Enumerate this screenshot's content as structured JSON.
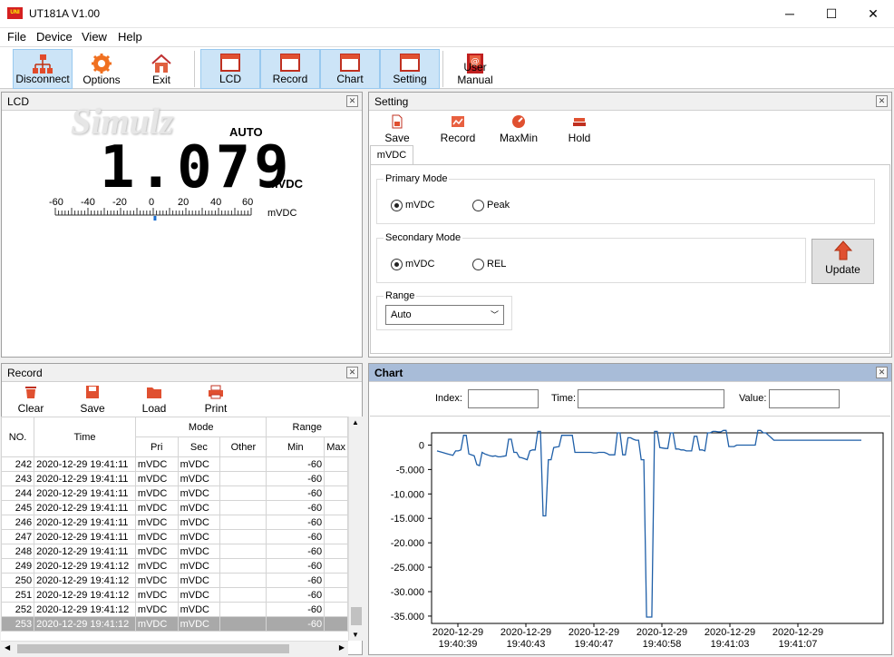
{
  "window": {
    "title": "UT181A V1.00",
    "minimize": "─",
    "maximize": "☐",
    "close": "✕"
  },
  "menu": [
    "File",
    "Device",
    "View",
    "Help"
  ],
  "toolbar": {
    "disconnect": "Disconnect",
    "options": "Options",
    "exit": "Exit",
    "lcd": "LCD",
    "record": "Record",
    "chart": "Chart",
    "setting": "Setting",
    "user_manual": "User Manual"
  },
  "lcd_panel": {
    "title": "LCD",
    "watermark": "Simulz",
    "range_mode": "AUTO",
    "reading": "1.079",
    "unit": "mVDC",
    "scale_unit": "mVDC",
    "scale_labels": [
      "-60",
      "-40",
      "-20",
      "0",
      "20",
      "40",
      "60"
    ],
    "bar_value": 1.079
  },
  "setting_panel": {
    "title": "Setting",
    "buttons": {
      "save": "Save",
      "record": "Record",
      "maxmin": "MaxMin",
      "hold": "Hold"
    },
    "tab": "mVDC",
    "primary_mode": {
      "label": "Primary Mode",
      "options": [
        "mVDC",
        "Peak"
      ],
      "selected": "mVDC"
    },
    "secondary_mode": {
      "label": "Secondary Mode",
      "options": [
        "mVDC",
        "REL"
      ],
      "selected": "mVDC"
    },
    "update": "Update",
    "range": {
      "label": "Range",
      "value": "Auto"
    }
  },
  "record_panel": {
    "title": "Record",
    "buttons": {
      "clear": "Clear",
      "save": "Save",
      "load": "Load",
      "print": "Print"
    },
    "headers": {
      "no": "NO.",
      "time": "Time",
      "mode": "Mode",
      "range": "Range",
      "pri": "Pri",
      "sec": "Sec",
      "other": "Other",
      "min": "Min",
      "max": "Max"
    },
    "rows": [
      {
        "no": "242",
        "time": "2020-12-29 19:41:11",
        "pri": "mVDC",
        "sec": "mVDC",
        "other": "",
        "min": "-60"
      },
      {
        "no": "243",
        "time": "2020-12-29 19:41:11",
        "pri": "mVDC",
        "sec": "mVDC",
        "other": "",
        "min": "-60"
      },
      {
        "no": "244",
        "time": "2020-12-29 19:41:11",
        "pri": "mVDC",
        "sec": "mVDC",
        "other": "",
        "min": "-60"
      },
      {
        "no": "245",
        "time": "2020-12-29 19:41:11",
        "pri": "mVDC",
        "sec": "mVDC",
        "other": "",
        "min": "-60"
      },
      {
        "no": "246",
        "time": "2020-12-29 19:41:11",
        "pri": "mVDC",
        "sec": "mVDC",
        "other": "",
        "min": "-60"
      },
      {
        "no": "247",
        "time": "2020-12-29 19:41:11",
        "pri": "mVDC",
        "sec": "mVDC",
        "other": "",
        "min": "-60"
      },
      {
        "no": "248",
        "time": "2020-12-29 19:41:11",
        "pri": "mVDC",
        "sec": "mVDC",
        "other": "",
        "min": "-60"
      },
      {
        "no": "249",
        "time": "2020-12-29 19:41:12",
        "pri": "mVDC",
        "sec": "mVDC",
        "other": "",
        "min": "-60"
      },
      {
        "no": "250",
        "time": "2020-12-29 19:41:12",
        "pri": "mVDC",
        "sec": "mVDC",
        "other": "",
        "min": "-60"
      },
      {
        "no": "251",
        "time": "2020-12-29 19:41:12",
        "pri": "mVDC",
        "sec": "mVDC",
        "other": "",
        "min": "-60"
      },
      {
        "no": "252",
        "time": "2020-12-29 19:41:12",
        "pri": "mVDC",
        "sec": "mVDC",
        "other": "",
        "min": "-60"
      },
      {
        "no": "253",
        "time": "2020-12-29 19:41:12",
        "pri": "mVDC",
        "sec": "mVDC",
        "other": "",
        "min": "-60",
        "selected": true
      }
    ]
  },
  "chart_panel": {
    "title": "Chart",
    "index_label": "Index:",
    "time_label": "Time:",
    "value_label": "Value:",
    "index_value": "",
    "time_value": "",
    "value_value": ""
  },
  "chart_data": {
    "type": "line",
    "y_ticks": [
      "0",
      "-5.000",
      "-10.000",
      "-15.000",
      "-20.000",
      "-25.000",
      "-30.000",
      "-35.000"
    ],
    "x_ticks": [
      {
        "date": "2020-12-29",
        "time": "19:40:39"
      },
      {
        "date": "2020-12-29",
        "time": "19:40:43"
      },
      {
        "date": "2020-12-29",
        "time": "19:40:47"
      },
      {
        "date": "2020-12-29",
        "time": "19:40:58"
      },
      {
        "date": "2020-12-29",
        "time": "19:41:03"
      },
      {
        "date": "2020-12-29",
        "time": "19:41:07"
      }
    ],
    "ylim": [
      -36500,
      2500
    ],
    "x": [
      0,
      2,
      4,
      6,
      7,
      8,
      9,
      10,
      11,
      12,
      13,
      14,
      15,
      16,
      17,
      18,
      19,
      20,
      21,
      22,
      23,
      24,
      25,
      26,
      27,
      28,
      29,
      30,
      31,
      32,
      33,
      34,
      35,
      36,
      37,
      38,
      39,
      40,
      41,
      42,
      43,
      44,
      45,
      46,
      47,
      48,
      49,
      50,
      51,
      52,
      53,
      54,
      55,
      56,
      57,
      58,
      59,
      60,
      61,
      62,
      63,
      64,
      65,
      66,
      67,
      68,
      69,
      70,
      71,
      72,
      73,
      74,
      75,
      76,
      77,
      78,
      79,
      80,
      81,
      82,
      83,
      84,
      85,
      86,
      87,
      88,
      89,
      90,
      91,
      92,
      93,
      94,
      95,
      96,
      97,
      98,
      99,
      100,
      101,
      102,
      103,
      104,
      105,
      106,
      107,
      108,
      109,
      110,
      111,
      112,
      113,
      114,
      115,
      116,
      117,
      118,
      119,
      120,
      121,
      122,
      123,
      124,
      125,
      126,
      127,
      128,
      129,
      130,
      131,
      132,
      133,
      134,
      135,
      136,
      137,
      138,
      139,
      140,
      141,
      142,
      143,
      144,
      145,
      146,
      147,
      148,
      149,
      150,
      151,
      152,
      153,
      154,
      155,
      156,
      157,
      158,
      159,
      160
    ],
    "values": [
      -1200,
      -1500,
      -1800,
      -2100,
      -1200,
      -1200,
      -1000,
      2000,
      2000,
      -1800,
      -2000,
      -2200,
      -4000,
      -4200,
      -1500,
      -1800,
      -2000,
      -2200,
      -2300,
      -2200,
      -2400,
      -2400,
      -2300,
      -2200,
      1200,
      1200,
      -1500,
      -1500,
      -2500,
      -2600,
      -2800,
      -3000,
      -1200,
      -1000,
      -1000,
      2800,
      2800,
      -14500,
      -14500,
      -3000,
      -3000,
      -500,
      -400,
      -300,
      2000,
      2000,
      2000,
      2000,
      2000,
      -1500,
      -1500,
      -1500,
      -1500,
      -1500,
      -1500,
      -1500,
      -1600,
      -1600,
      -1500,
      -1500,
      -1500,
      -1700,
      -2000,
      -2000,
      -2000,
      2500,
      2500,
      -2000,
      -2000,
      1500,
      1500,
      1200,
      1000,
      1000,
      -3000,
      -3000,
      -35200,
      -35200,
      -35200,
      2800,
      2800,
      -500,
      -600,
      -700,
      -700,
      2500,
      2500,
      -800,
      -800,
      -1000,
      -1000,
      -1200,
      -1200,
      -1200,
      1800,
      1800,
      -1000,
      -1000,
      -1200,
      2500,
      2500,
      2800,
      2800,
      2700,
      2700,
      3000,
      3000,
      -300,
      -300,
      -300,
      0,
      0,
      0,
      0,
      0,
      0,
      0,
      0,
      3000,
      3000,
      2500,
      2500,
      2000,
      1500,
      1000,
      1000,
      1000,
      1000,
      1000,
      1000,
      1000,
      1000,
      1000,
      1000,
      1000,
      1000,
      1000,
      1000,
      1000,
      1000,
      1000,
      1000,
      1000,
      1000,
      1000,
      1000,
      1000,
      1000,
      1000,
      1000,
      1000,
      1000,
      1000,
      1000,
      1000,
      1000,
      1000,
      1000,
      1000,
      1000,
      1000,
      1000,
      1000,
      1000,
      1000
    ]
  }
}
